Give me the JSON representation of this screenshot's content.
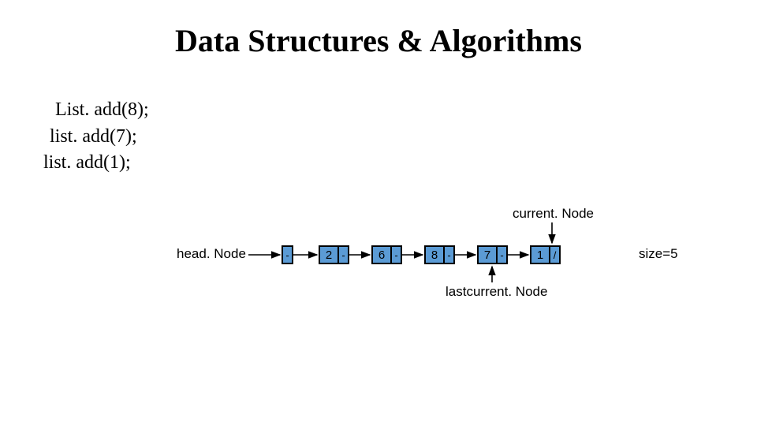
{
  "title": "Data Structures & Algorithms",
  "code": {
    "l1": "List. add(8);",
    "l2": "list. add(7);",
    "l3": "list. add(1);"
  },
  "labels": {
    "head": "head. Node",
    "current": "current. Node",
    "last": "lastcurrent. Node",
    "size": "size=5"
  },
  "nodes": {
    "n1": "2",
    "n2": "6",
    "n3": "8",
    "n4": "7",
    "n5": "1",
    "ptr": "-",
    "nil": "/"
  }
}
